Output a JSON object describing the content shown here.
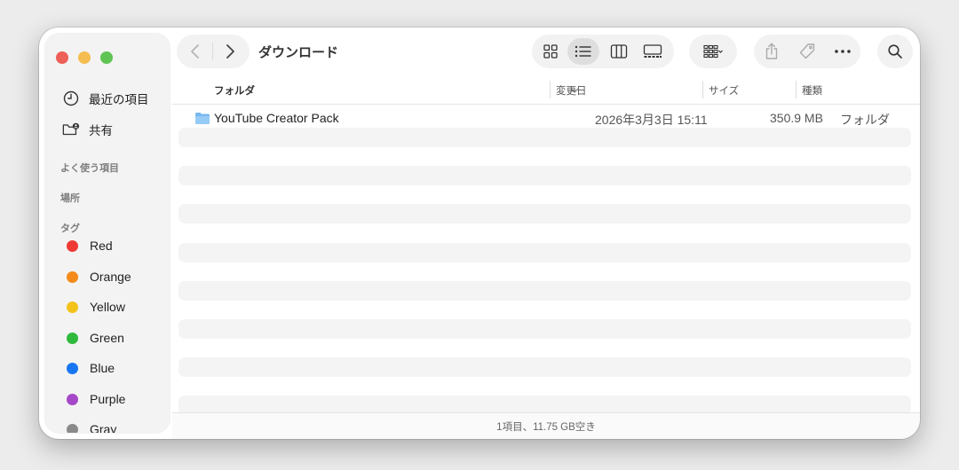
{
  "window": {
    "title": "ダウンロード"
  },
  "sidebar": {
    "items": [
      {
        "label": "最近の項目",
        "icon": "clock-icon"
      },
      {
        "label": "共有",
        "icon": "shared-folder-icon"
      }
    ],
    "sections": {
      "favorites": "よく使う項目",
      "locations": "場所",
      "tags": "タグ"
    },
    "tags": [
      {
        "label": "Red",
        "color": "#ee3a33"
      },
      {
        "label": "Orange",
        "color": "#f58b1b"
      },
      {
        "label": "Yellow",
        "color": "#f4c31a"
      },
      {
        "label": "Green",
        "color": "#2fba3d"
      },
      {
        "label": "Blue",
        "color": "#1876f2"
      },
      {
        "label": "Purple",
        "color": "#a548c7"
      },
      {
        "label": "Gray",
        "color": "#8a8a8a"
      }
    ]
  },
  "columns": {
    "name": "フォルダ",
    "date": "変更日",
    "size": "サイズ",
    "kind": "種類"
  },
  "files": [
    {
      "name": "YouTube Creator Pack",
      "date": "2026年3月3日 15:11",
      "size": "350.9 MB",
      "kind": "フォルダ",
      "icon": "folder-icon"
    }
  ],
  "status": {
    "text": "1項目、11.75 GB空き"
  }
}
